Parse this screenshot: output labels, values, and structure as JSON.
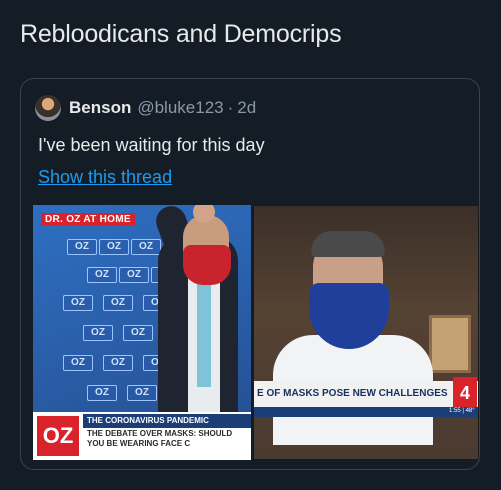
{
  "tweet": {
    "text": "Rebloodicans and Democrips"
  },
  "quote": {
    "name": "Benson",
    "handle": "@bluke123",
    "separator": "·",
    "time": "2d",
    "body": "I've been waiting for this day",
    "show_thread": "Show this thread"
  },
  "media": {
    "left": {
      "banner": "DR. OZ AT HOME",
      "oz_tile": "OZ",
      "logo": "OZ",
      "headline": "THE CORONAVIRUS PANDEMIC",
      "subheadline": "THE DEBATE OVER MASKS: SHOULD YOU BE WEARING FACE C"
    },
    "right": {
      "headline": "E OF MASKS POSE NEW CHALLENGES",
      "channel": "4",
      "ticker": "1:55 | 48°"
    }
  },
  "colors": {
    "background": "#141d26",
    "link": "#1d9bf0",
    "border": "#38444d"
  }
}
